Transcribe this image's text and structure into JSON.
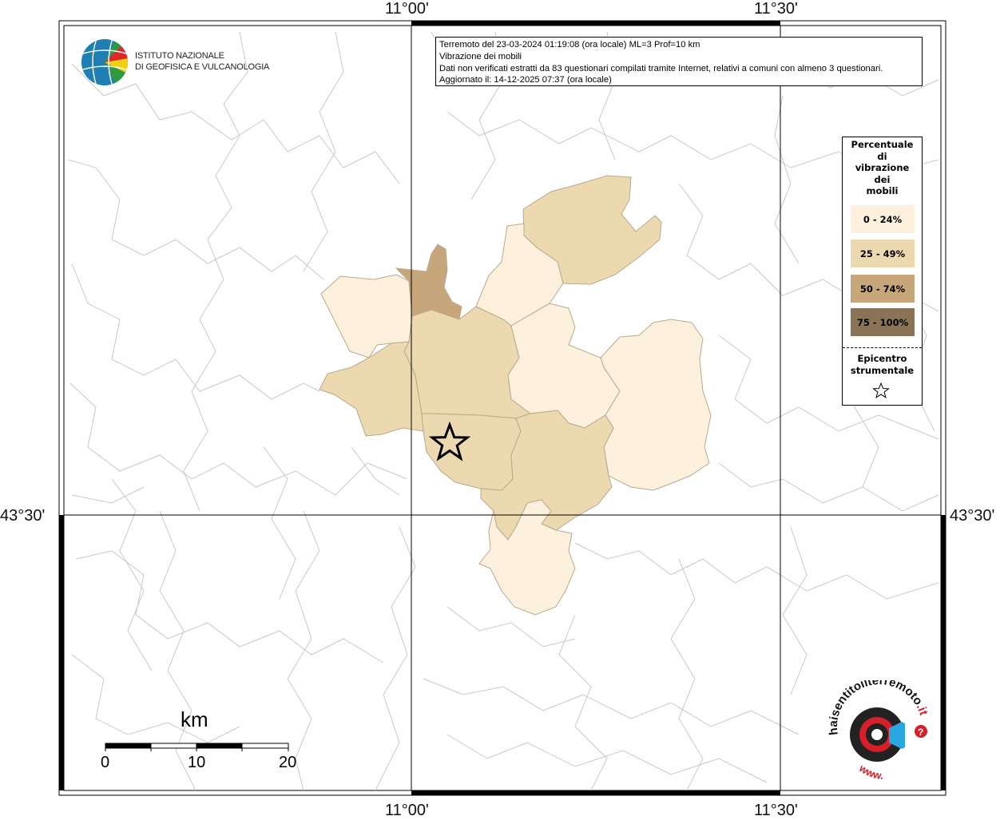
{
  "info": {
    "line1": "Terremoto del 23-03-2024 01:19:08 (ora locale) ML=3 Prof=10 km",
    "line2": "Vibrazione dei mobili",
    "line3": "Dati non verificati estratti da 83 questionari compilati tramite Internet, relativi a comuni con almeno 3 questionari.",
    "line4": "Aggiornato il: 14-12-2025 07:37 (ora locale)"
  },
  "axes": {
    "lon_left": "11°00'",
    "lon_right": "11°30'",
    "lat": "43°30'"
  },
  "logo": {
    "line1": "ISTITUTO NAZIONALE",
    "line2": "DI GEOFISICA E VULCANOLOGIA"
  },
  "legend": {
    "title_lines": [
      "Percentuale",
      "di",
      "vibrazione",
      "dei",
      "mobili"
    ],
    "classes": [
      {
        "label": "0 - 24%",
        "color": "#fdf0dc"
      },
      {
        "label": "25 - 49%",
        "color": "#ecd9b0"
      },
      {
        "label": "50 - 74%",
        "color": "#c8a67c"
      },
      {
        "label": "75 - 100%",
        "color": "#8a7356"
      }
    ],
    "epicenter_line1": "Epicentro",
    "epicenter_line2": "strumentale"
  },
  "scale": {
    "unit": "km",
    "ticks": [
      "0",
      "10",
      "20"
    ]
  },
  "brand": {
    "text_top": "hai",
    "text_main": "sentitoilterremoto",
    "text_tld": ".it",
    "text_bottom": "www."
  }
}
